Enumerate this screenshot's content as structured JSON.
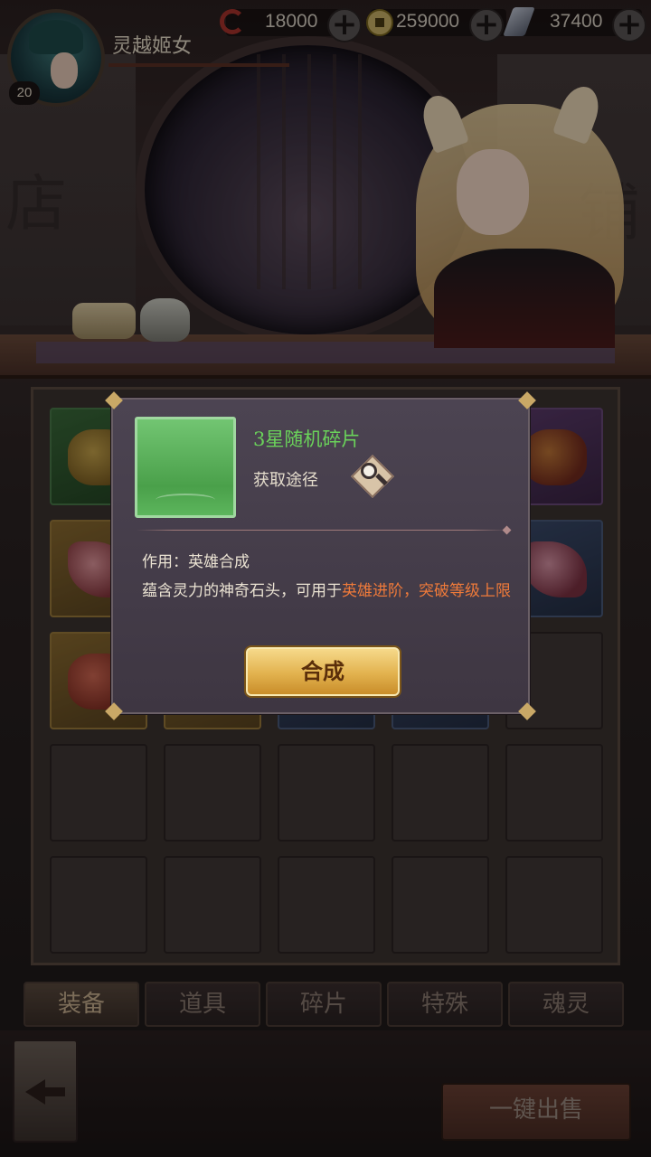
{
  "top_bar": {
    "player_name": "灵越姬女",
    "player_level": "20",
    "resources": [
      {
        "icon": "red-swirl-icon",
        "value": "18000"
      },
      {
        "icon": "coin-icon",
        "value": "259000"
      },
      {
        "icon": "feather-icon",
        "value": "37400"
      }
    ]
  },
  "background": {
    "left_sign": "店",
    "right_sign": "铺"
  },
  "popup": {
    "item_name": "3星随机碎片",
    "obtain_label": "获取途径",
    "use_line": "作用：英雄合成",
    "desc_plain": "蕴含灵力的神奇石头，可用于",
    "desc_highlight": "英雄进阶，突破等级上限",
    "compose_button": "合成",
    "colors": {
      "name": "#6ad25a",
      "highlight": "#ef7a3a"
    }
  },
  "tabs": [
    "装备",
    "道具",
    "碎片",
    "特殊",
    "魂灵"
  ],
  "active_tab": "装备",
  "sell_all_button": "一键出售"
}
